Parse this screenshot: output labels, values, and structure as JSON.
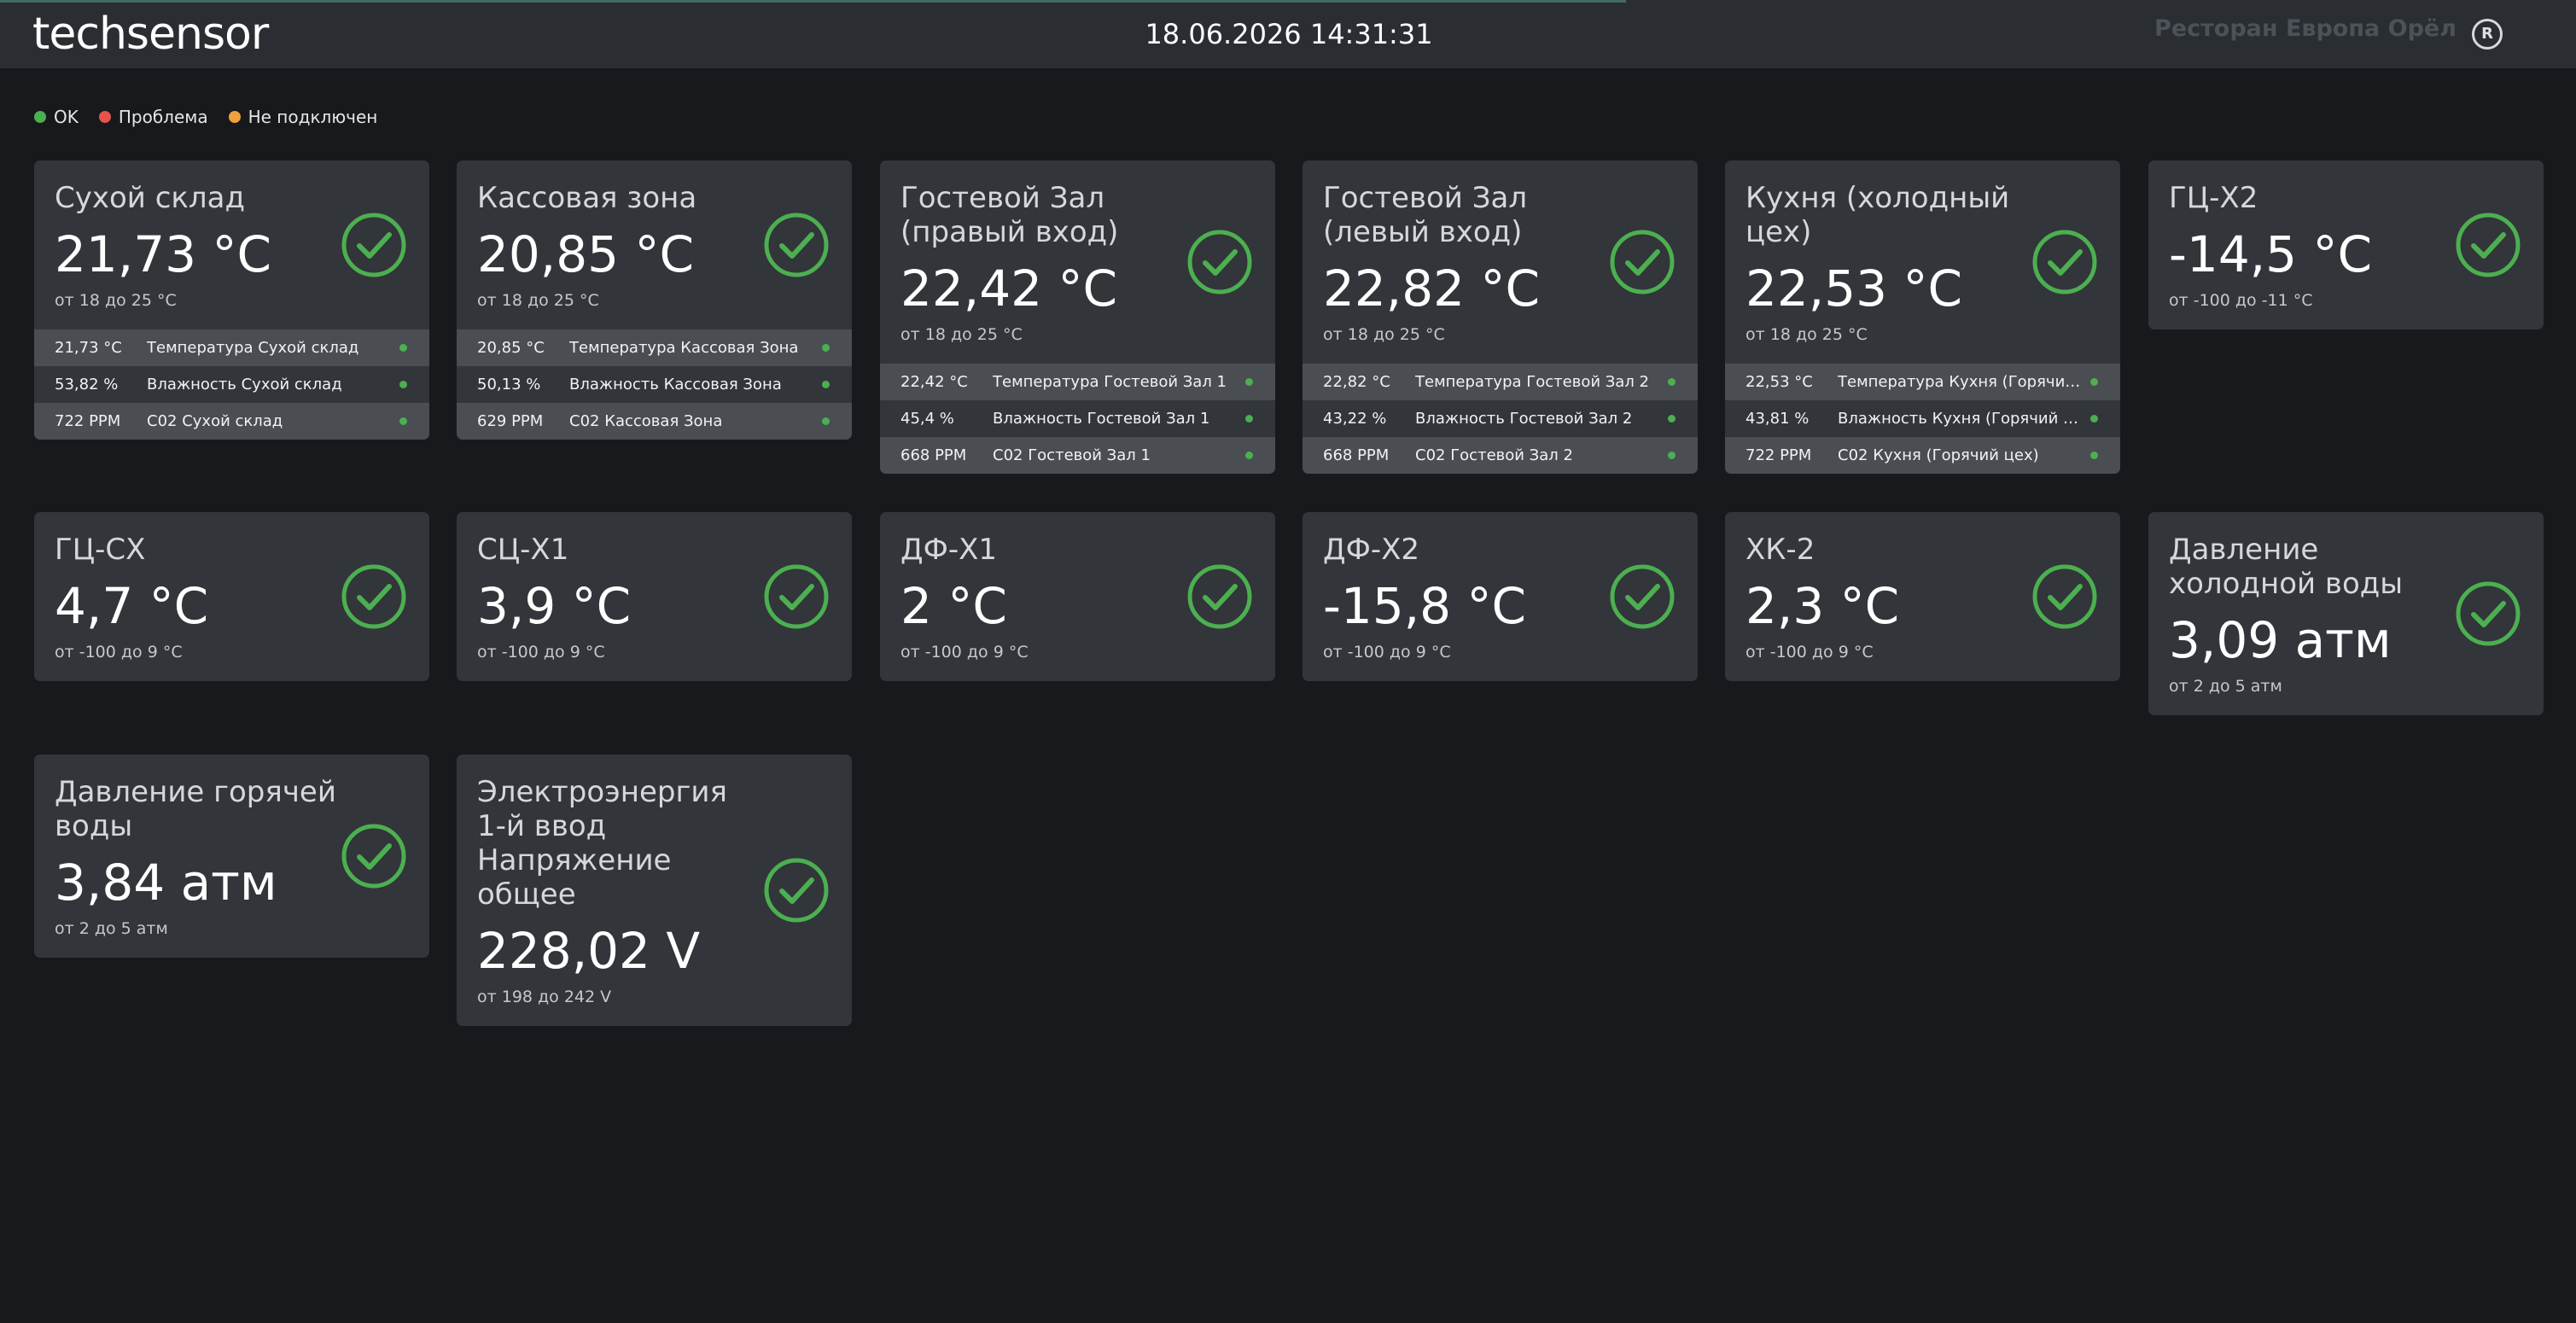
{
  "header": {
    "logo": "techsensor",
    "datetime": "18.06.2026 14:31:31",
    "organization": "Ресторан Европа Орёл",
    "organization_icon": "R"
  },
  "legend": [
    {
      "label": "OK",
      "color": "#4caf50"
    },
    {
      "label": "Проблема",
      "color": "#e5534b"
    },
    {
      "label": "Не подключен",
      "color": "#f0a040"
    }
  ],
  "colors": {
    "ok": "#4caf50",
    "card_bg": "#32353a",
    "page_bg": "#17191c"
  },
  "cards": [
    {
      "title": "Сухой склад",
      "value": "21,73 °C",
      "range": "от 18 до 25 °C",
      "status": "ok",
      "status_icon": "check-circle-icon",
      "rows": [
        {
          "value": "21,73 °C",
          "label": "Температура Сухой склад"
        },
        {
          "value": "53,82 %",
          "label": "Влажность Сухой склад"
        },
        {
          "value": "722 PPM",
          "label": "C02 Сухой склад"
        }
      ]
    },
    {
      "title": "Кассовая зона",
      "value": "20,85 °C",
      "range": "от 18 до 25 °C",
      "status": "ok",
      "status_icon": "check-circle-icon",
      "rows": [
        {
          "value": "20,85 °C",
          "label": "Температура Кассовая Зона"
        },
        {
          "value": "50,13 %",
          "label": "Влажность Кассовая Зона"
        },
        {
          "value": "629 PPM",
          "label": "C02 Кассовая Зона"
        }
      ]
    },
    {
      "title": "Гостевой Зал (правый вход)",
      "value": "22,42 °C",
      "range": "от 18 до 25 °C",
      "status": "ok",
      "status_icon": "check-circle-icon",
      "rows": [
        {
          "value": "22,42 °C",
          "label": "Температура Гостевой Зал 1"
        },
        {
          "value": "45,4 %",
          "label": "Влажность Гостевой Зал 1"
        },
        {
          "value": "668 PPM",
          "label": "C02 Гостевой Зал 1"
        }
      ]
    },
    {
      "title": "Гостевой Зал (левый вход)",
      "value": "22,82 °C",
      "range": "от 18 до 25 °C",
      "status": "ok",
      "status_icon": "check-circle-icon",
      "rows": [
        {
          "value": "22,82 °C",
          "label": "Температура Гостевой Зал 2"
        },
        {
          "value": "43,22 %",
          "label": "Влажность Гостевой Зал 2"
        },
        {
          "value": "668 PPM",
          "label": "C02 Гостевой Зал 2"
        }
      ]
    },
    {
      "title": "Кухня (холодный цех)",
      "value": "22,53 °C",
      "range": "от 18 до 25 °C",
      "status": "ok",
      "status_icon": "check-circle-icon",
      "rows": [
        {
          "value": "22,53 °C",
          "label": "Температура Кухня (Горячий цех)"
        },
        {
          "value": "43,81 %",
          "label": "Влажность Кухня (Горячий цех)"
        },
        {
          "value": "722 PPM",
          "label": "C02 Кухня (Горячий цех)"
        }
      ]
    },
    {
      "title": "ГЦ-Х2",
      "value": "-14,5 °C",
      "range": "от -100 до -11 °C",
      "status": "ok",
      "status_icon": "check-circle-icon",
      "rows": []
    },
    {
      "title": "ГЦ-СХ",
      "value": "4,7 °C",
      "range": "от -100 до 9 °C",
      "status": "ok",
      "status_icon": "check-circle-icon",
      "rows": []
    },
    {
      "title": "СЦ-Х1",
      "value": "3,9 °C",
      "range": "от -100 до 9 °C",
      "status": "ok",
      "status_icon": "check-circle-icon",
      "rows": []
    },
    {
      "title": "ДФ-Х1",
      "value": "2 °C",
      "range": "от -100 до 9 °C",
      "status": "ok",
      "status_icon": "check-circle-icon",
      "rows": []
    },
    {
      "title": "ДФ-Х2",
      "value": "-15,8 °C",
      "range": "от -100 до 9 °C",
      "status": "ok",
      "status_icon": "check-circle-icon",
      "rows": []
    },
    {
      "title": "ХК-2",
      "value": "2,3 °C",
      "range": "от -100 до 9 °C",
      "status": "ok",
      "status_icon": "check-circle-icon",
      "rows": []
    },
    {
      "title": "Давление холодной воды",
      "value": "3,09 атм",
      "range": "от 2 до 5 атм",
      "status": "ok",
      "status_icon": "check-circle-icon",
      "rows": []
    },
    {
      "title": "Давление горячей воды",
      "value": "3,84 атм",
      "range": "от 2 до 5 атм",
      "status": "ok",
      "status_icon": "check-circle-icon",
      "rows": []
    },
    {
      "title": "Электроэнергия 1-й ввод Напряжение общее",
      "value": "228,02 V",
      "range": "от 198 до 242 V",
      "status": "ok",
      "status_icon": "check-circle-icon",
      "rows": []
    }
  ]
}
